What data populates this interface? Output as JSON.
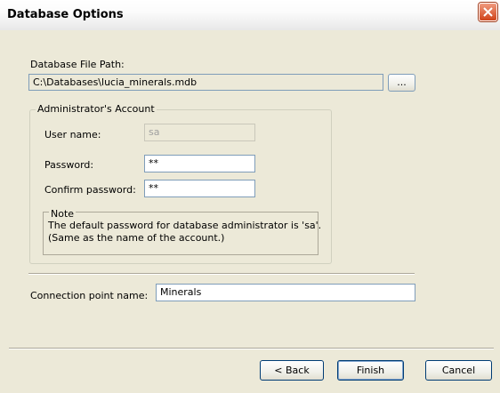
{
  "window": {
    "title": "Database Options",
    "close_icon": "close-icon"
  },
  "db_path": {
    "label": "Database File Path:",
    "value": "C:\\Databases\\lucia_minerals.mdb",
    "browse_label": "..."
  },
  "admin": {
    "group_label": "Administrator's Account",
    "username_label": "User name:",
    "username_value": "sa",
    "password_label": "Password:",
    "password_value": "**",
    "confirm_label": "Confirm password:",
    "confirm_value": "**"
  },
  "note": {
    "label": "Note",
    "line1": "The default password for database administrator is 'sa'.",
    "line2": "(Same as the name of the account.)"
  },
  "connection": {
    "label": "Connection point name:",
    "value": "Minerals"
  },
  "buttons": {
    "back": "< Back",
    "finish": "Finish",
    "cancel": "Cancel"
  }
}
